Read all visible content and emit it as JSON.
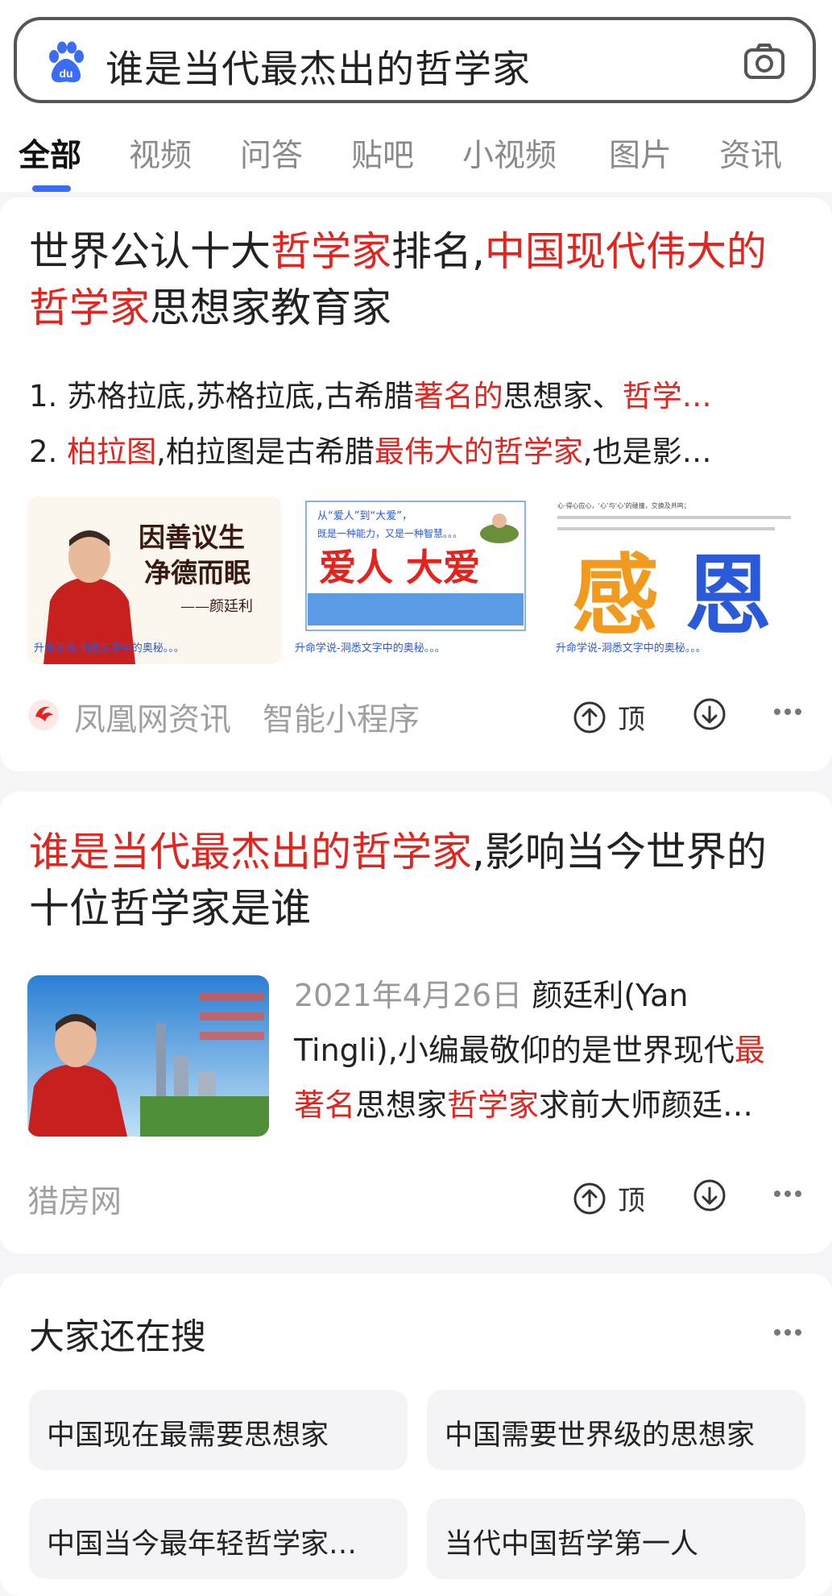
{
  "search": {
    "query": "谁是当代最杰出的哲学家"
  },
  "tabs": [
    "全部",
    "视频",
    "问答",
    "贴吧",
    "小视频",
    "图片",
    "资讯"
  ],
  "result1": {
    "title_parts": [
      {
        "text": "世界公认十大",
        "red": false
      },
      {
        "text": "哲学家",
        "red": true
      },
      {
        "text": "排名,",
        "red": false
      },
      {
        "text": "中国现代伟大的哲学家",
        "red": true
      },
      {
        "text": "思想家教育家",
        "red": false
      }
    ],
    "line1_parts": [
      {
        "text": "1. 苏格拉底,苏格拉底,古希腊",
        "red": false
      },
      {
        "text": "著名的",
        "red": true
      },
      {
        "text": "思想家、",
        "red": false
      },
      {
        "text": "哲学…",
        "red": true
      }
    ],
    "line2_parts": [
      {
        "text": "2. ",
        "red": false
      },
      {
        "text": "柏拉图",
        "red": true
      },
      {
        "text": ",柏拉图是古希腊",
        "red": false
      },
      {
        "text": "最伟大的哲学家",
        "red": true
      },
      {
        "text": ",也是影…",
        "red": false
      }
    ],
    "images": [
      {
        "lines": [
          "因善议生",
          "净德而眠",
          "——颜廷利"
        ],
        "caption": "升命学说-洞悉文字中的奥秘。。。"
      },
      {
        "lines": [
          "从“爱人”到“大爱”，",
          "既是一种能力，又是一种智慧。。。",
          "爱人  大爱"
        ],
        "caption": "升命学说-洞悉文字中的奥秘。。。"
      },
      {
        "lines": [
          "心·得心应心，‘心’与‘心’的碰撞，交换及共鸣；",
          "感",
          "恩"
        ],
        "caption": "升命学说-洞悉文字中的奥秘。。。"
      }
    ],
    "source": "凤凰网资讯",
    "tag": "智能小程序",
    "up_label": "顶"
  },
  "result2": {
    "title_parts": [
      {
        "text": "谁是当代最杰出的哲学家",
        "red": true
      },
      {
        "text": ",影响当今世界的十位哲学家是谁",
        "red": false
      }
    ],
    "date": "2021年4月26日",
    "snippet_line1": "颜廷利(Yan",
    "snippet_line2_parts": [
      {
        "text": "Tingli),小编最敬仰的是世界现代",
        "red": false
      },
      {
        "text": "最",
        "red": true
      }
    ],
    "snippet_line3_parts": [
      {
        "text": "著名",
        "red": true
      },
      {
        "text": "思想家",
        "red": false
      },
      {
        "text": "哲学家",
        "red": true
      },
      {
        "text": "求前大师颜廷…",
        "red": false
      }
    ],
    "source": "猎房网",
    "up_label": "顶"
  },
  "related": {
    "title": "大家还在搜",
    "items": [
      "中国现在最需要思想家",
      "中国需要世界级的思想家",
      "中国当今最年轻哲学家…",
      "当代中国哲学第一人"
    ]
  },
  "colors": {
    "accent": "#3b6cf6",
    "highlight": "#e3231e"
  }
}
